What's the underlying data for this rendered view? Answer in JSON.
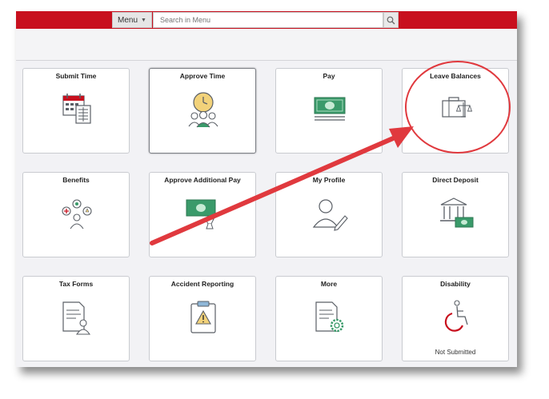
{
  "header": {
    "menu_label": "Menu",
    "search_placeholder": "Search in Menu"
  },
  "tiles": [
    {
      "title": "Submit Time",
      "icon": "calendar-icon"
    },
    {
      "title": "Approve Time",
      "icon": "approve-time-icon"
    },
    {
      "title": "Pay",
      "icon": "money-icon"
    },
    {
      "title": "Leave Balances",
      "icon": "leave-balances-icon"
    },
    {
      "title": "Benefits",
      "icon": "benefits-icon"
    },
    {
      "title": "Approve Additional Pay",
      "icon": "additional-pay-icon"
    },
    {
      "title": "My Profile",
      "icon": "profile-icon"
    },
    {
      "title": "Direct Deposit",
      "icon": "bank-icon"
    },
    {
      "title": "Tax Forms",
      "icon": "tax-form-icon"
    },
    {
      "title": "Accident Reporting",
      "icon": "clipboard-warning-icon"
    },
    {
      "title": "More",
      "icon": "document-gear-icon"
    },
    {
      "title": "Disability",
      "icon": "wheelchair-icon",
      "status": "Not Submitted"
    }
  ],
  "colors": {
    "brand_red": "#c8101e",
    "annotation_red": "#e0393e",
    "money_green": "#3a9a6a",
    "icon_gray": "#5a5f66"
  }
}
